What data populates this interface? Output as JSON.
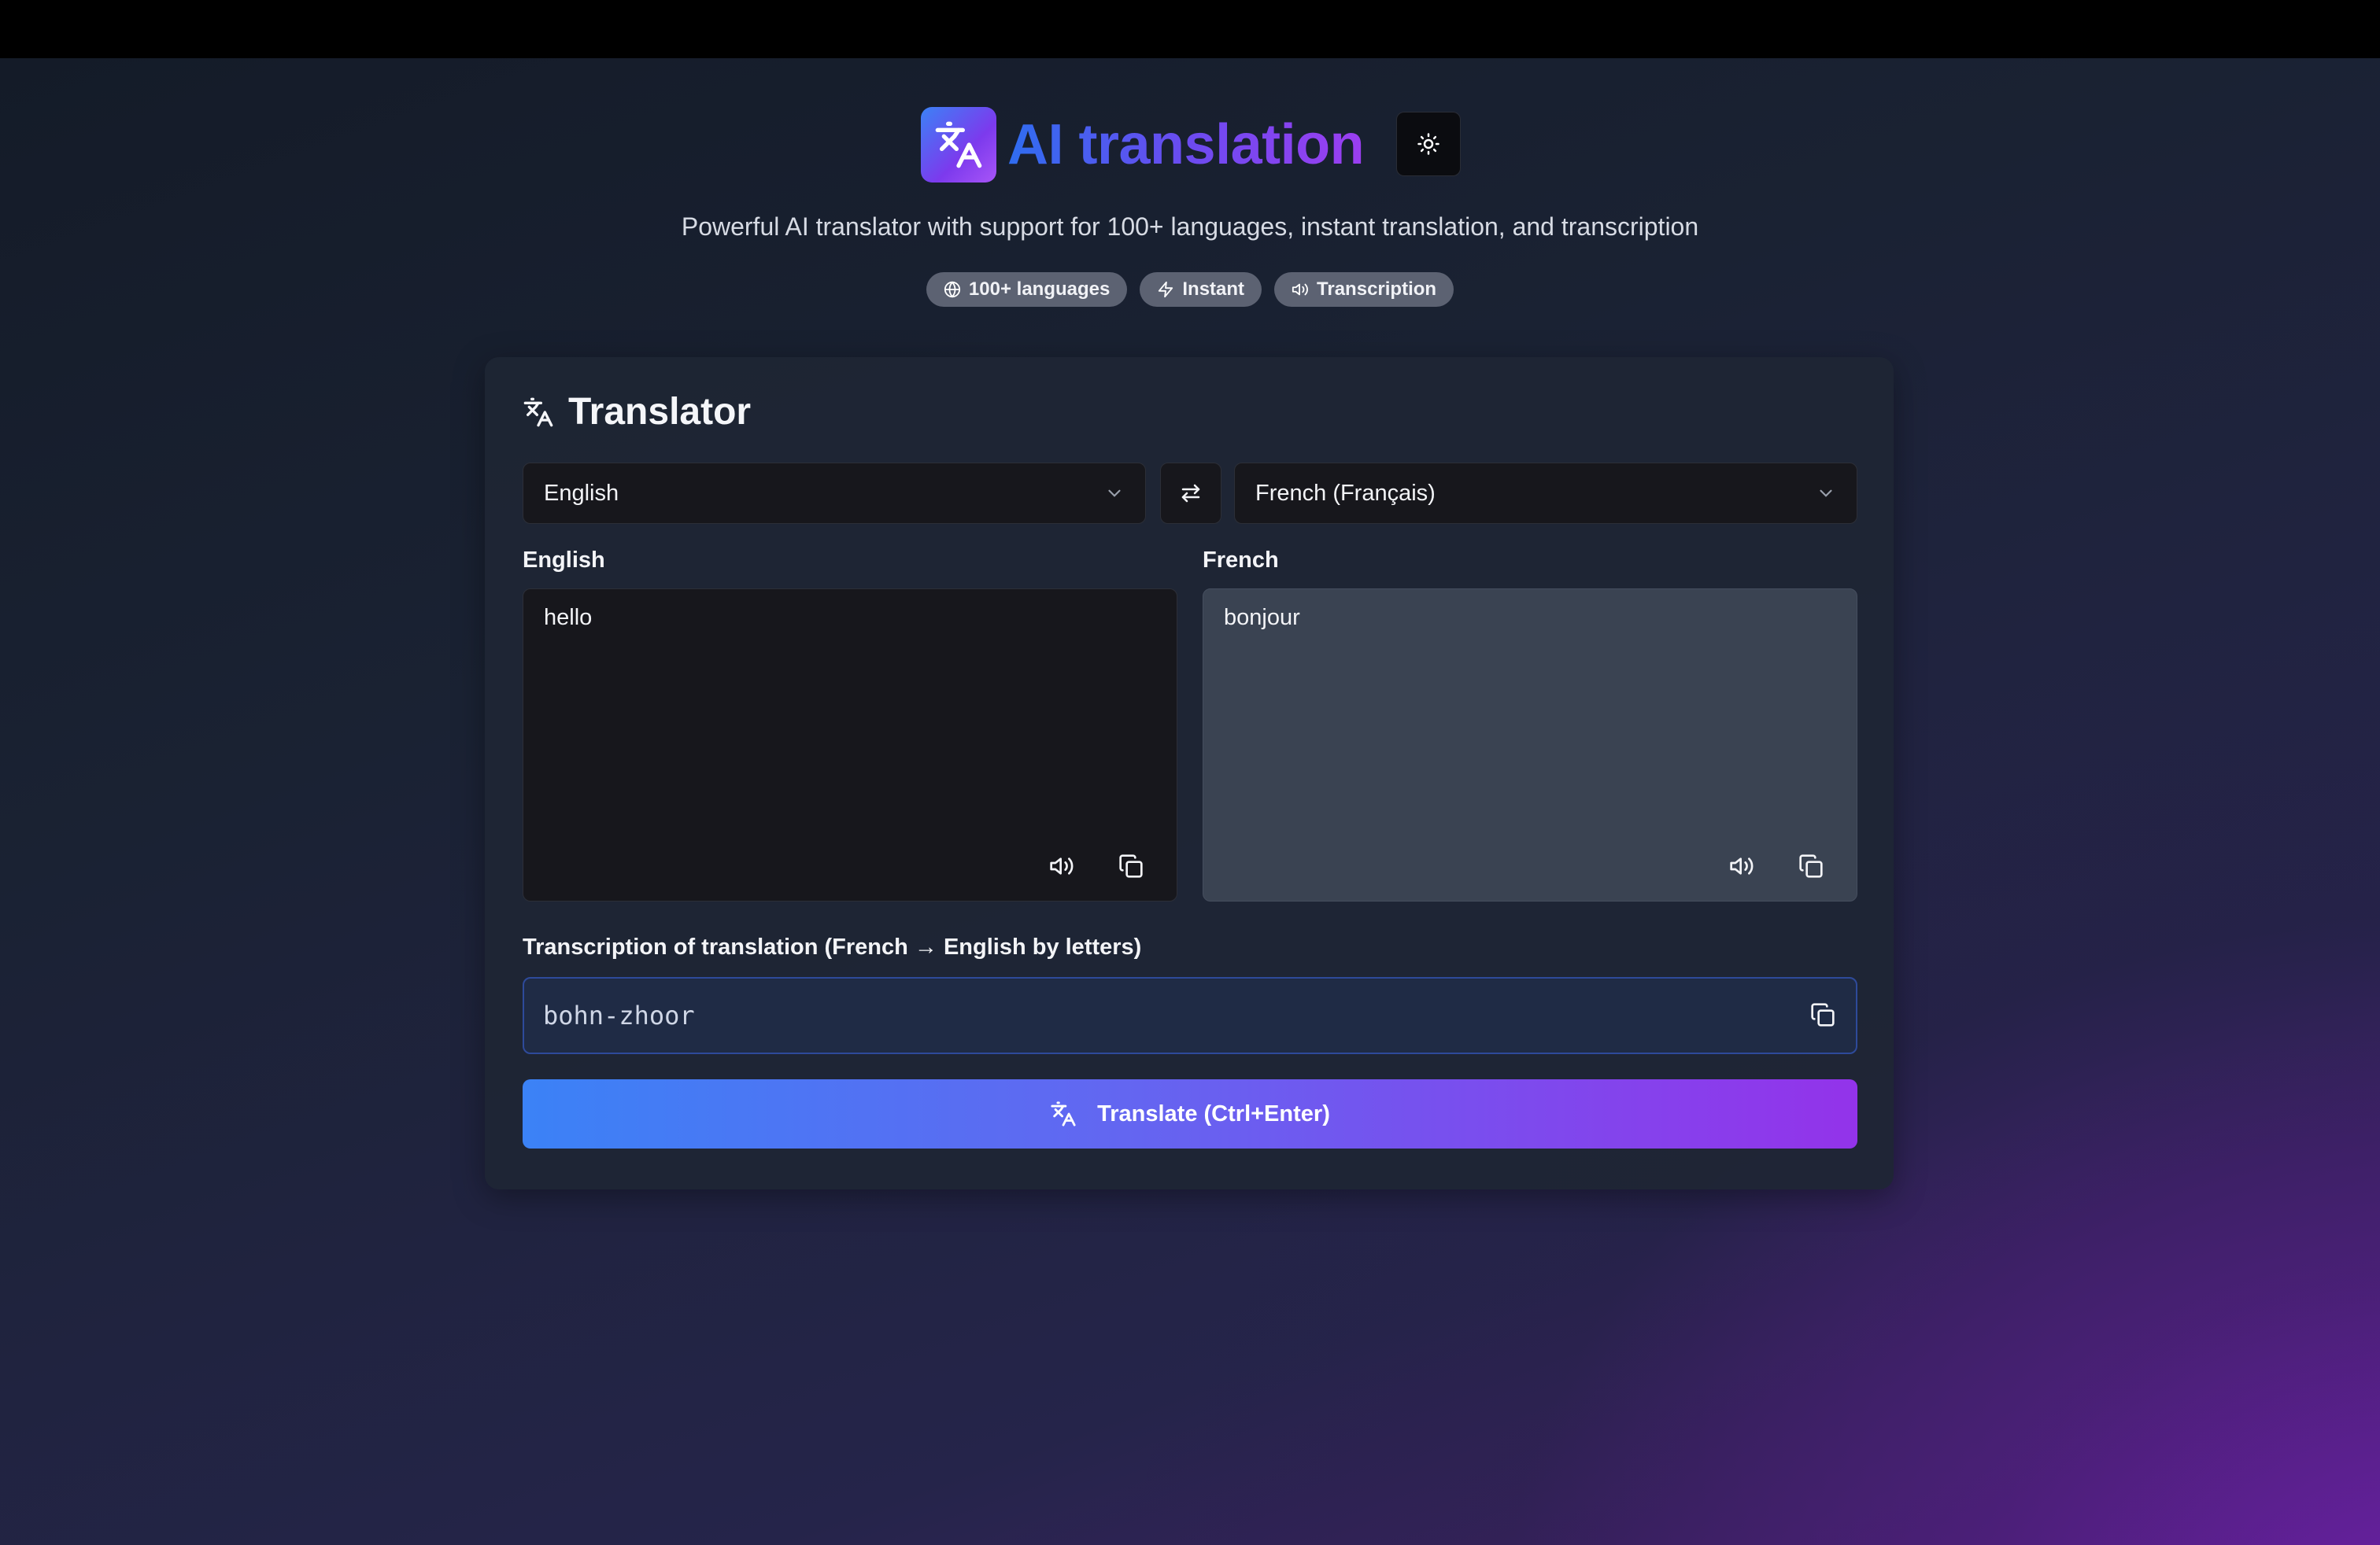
{
  "header": {
    "title": "AI translation",
    "subtitle": "Powerful AI translator with support for 100+ languages, instant translation, and transcription",
    "badges": [
      {
        "label": "100+ languages",
        "icon": "globe-icon"
      },
      {
        "label": "Instant",
        "icon": "lightning-icon"
      },
      {
        "label": "Transcription",
        "icon": "speaker-icon"
      }
    ],
    "theme_toggle_icon": "sun-icon"
  },
  "translator": {
    "title": "Translator",
    "source_language": "English",
    "target_language": "French (Français)",
    "source_label": "English",
    "target_label": "French",
    "source_text": "hello",
    "target_text": "bonjour",
    "transcription_label": "Transcription of translation (French → English by letters)",
    "transcription_text": "bohn-zhoor",
    "translate_button": "Translate (Ctrl+Enter)"
  },
  "colors": {
    "accent_blue": "#3b82f6",
    "accent_purple": "#9333ea",
    "badge_bg": "#5c6272"
  }
}
